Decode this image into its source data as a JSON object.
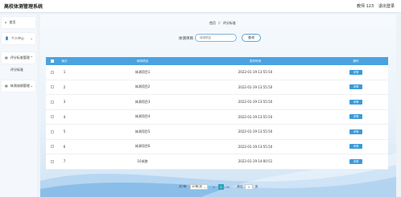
{
  "header": {
    "title": "高校体测管理系统",
    "user": "教师 123",
    "logout": "退出登录"
  },
  "sidebar": {
    "items": [
      {
        "label": "首页",
        "icon": "home-icon"
      },
      {
        "label": "个人中心",
        "icon": "user-icon"
      },
      {
        "label": "评分标准管理",
        "icon": "grid-icon"
      },
      {
        "label": "评分标准",
        "icon": ""
      },
      {
        "label": "体测成绩管理",
        "icon": "grid-icon"
      }
    ]
  },
  "breadcrumb": {
    "home": "首页",
    "sep": "//",
    "current": "评分标准"
  },
  "search": {
    "label": "体测项目",
    "placeholder": "体测项目",
    "button": "查询"
  },
  "table": {
    "headers": [
      "索引",
      "体测项目",
      "发布时间",
      "操作"
    ],
    "rows": [
      {
        "idx": "1",
        "name": "体测项目1",
        "date": "2022-01-19 13:55:50",
        "op": "详情"
      },
      {
        "idx": "2",
        "name": "体测项目2",
        "date": "2022-01-19 13:55:50",
        "op": "详情"
      },
      {
        "idx": "3",
        "name": "体测项目3",
        "date": "2022-01-19 13:55:50",
        "op": "详情"
      },
      {
        "idx": "4",
        "name": "体测项目4",
        "date": "2022-01-19 13:55:50",
        "op": "详情"
      },
      {
        "idx": "5",
        "name": "体测项目5",
        "date": "2022-01-19 13:55:50",
        "op": "详情"
      },
      {
        "idx": "6",
        "name": "体测项目6",
        "date": "2022-01-19 13:55:50",
        "op": "详情"
      },
      {
        "idx": "7",
        "name": "10米跑",
        "date": "2022-01-19 14:00:51",
        "op": "详情"
      }
    ]
  },
  "pager": {
    "total": "共7条",
    "page_size": "10条/页",
    "prev": "<",
    "current": "1",
    "next": ">",
    "goto": "前往",
    "goto_value": "1",
    "page_unit": "页"
  },
  "colors": {
    "accent": "#4aa3df",
    "button": "#3a9ad9",
    "pager_active": "#2fa3b8"
  }
}
